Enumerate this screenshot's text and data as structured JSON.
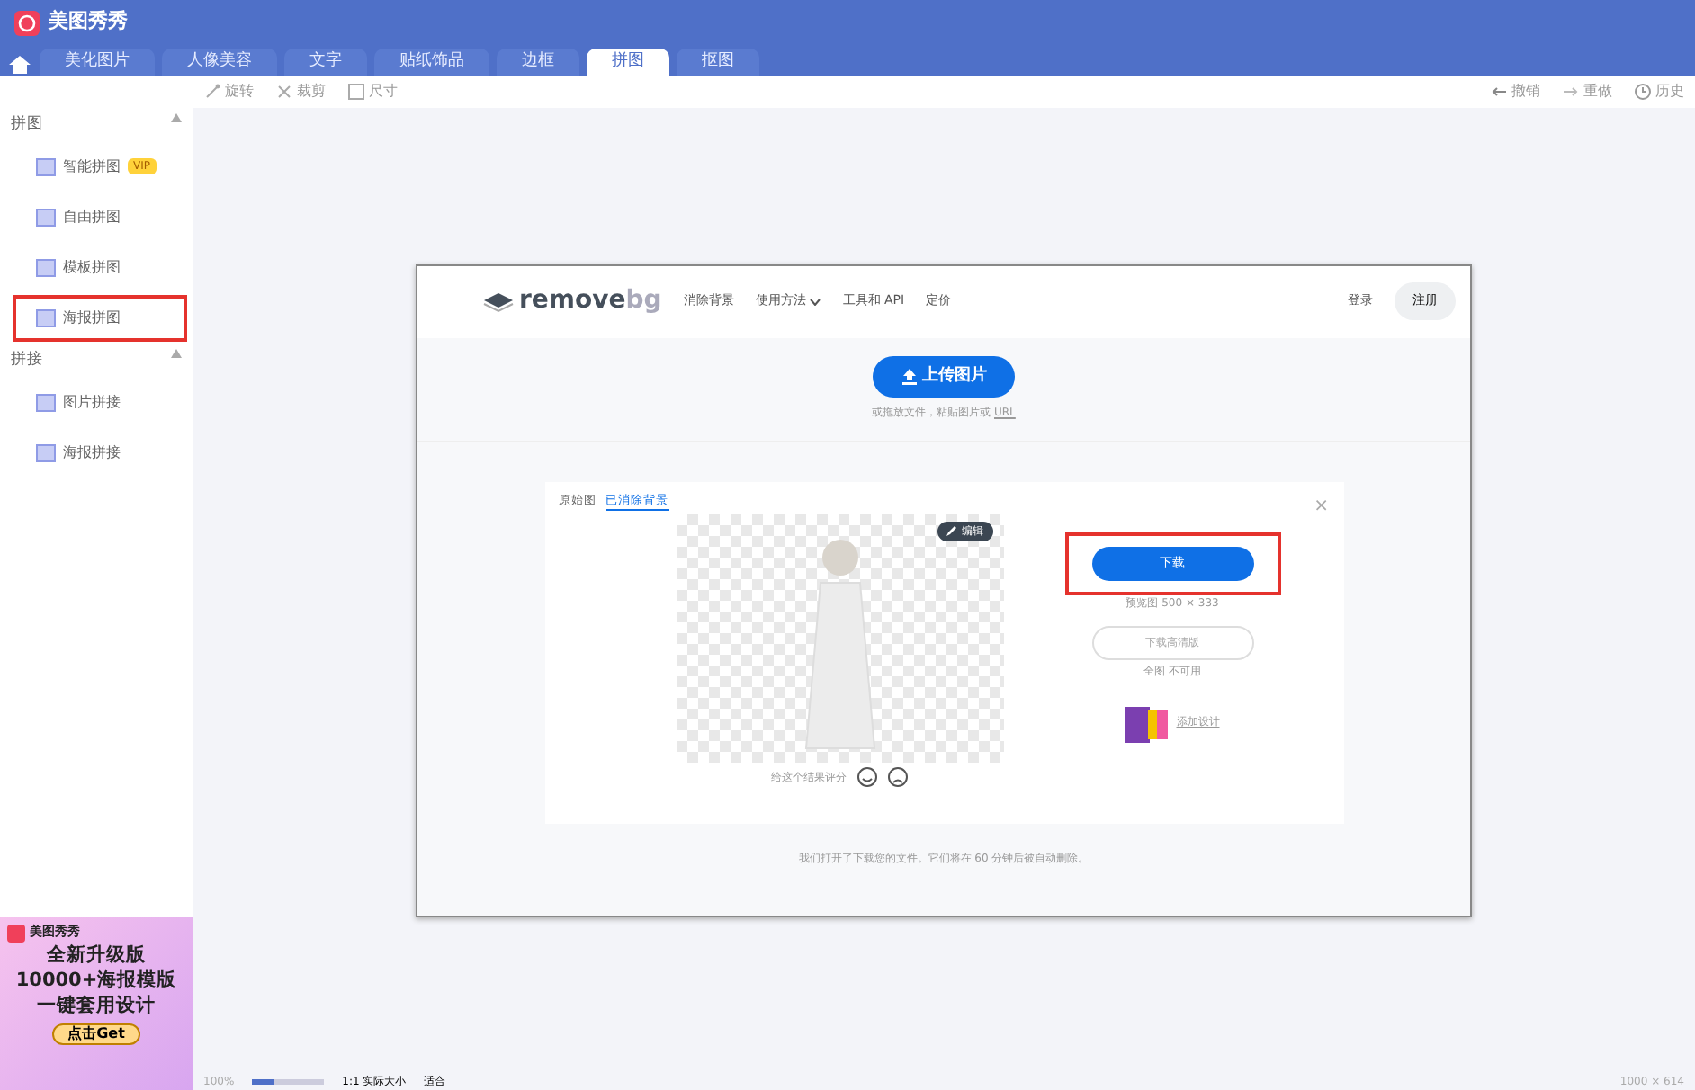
{
  "app": {
    "title": "美图秀秀"
  },
  "tabs": [
    {
      "label": "美化图片",
      "selected": false
    },
    {
      "label": "人像美容",
      "selected": false
    },
    {
      "label": "文字",
      "selected": false
    },
    {
      "label": "贴纸饰品",
      "selected": false
    },
    {
      "label": "边框",
      "selected": false
    },
    {
      "label": "拼图",
      "selected": true
    },
    {
      "label": "抠图",
      "selected": false
    }
  ],
  "toolbar": {
    "left": [
      {
        "kind": "rotate",
        "label": "旋转"
      },
      {
        "kind": "crop",
        "label": "裁剪"
      },
      {
        "kind": "size",
        "label": "尺寸"
      }
    ],
    "right": [
      {
        "kind": "undo",
        "label": "撤销"
      },
      {
        "kind": "redo",
        "label": "重做"
      },
      {
        "kind": "history",
        "label": "历史"
      }
    ]
  },
  "sidebar": [
    {
      "title": "拼图",
      "expanded": true,
      "items": [
        {
          "label": "智能拼图",
          "badge": "VIP",
          "highlighted": false
        },
        {
          "label": "自由拼图",
          "highlighted": false
        },
        {
          "label": "模板拼图",
          "highlighted": false
        },
        {
          "label": "海报拼图",
          "highlighted": true
        }
      ]
    },
    {
      "title": "拼接",
      "expanded": true,
      "items": [
        {
          "label": "图片拼接",
          "highlighted": false
        },
        {
          "label": "海报拼接",
          "highlighted": false
        }
      ]
    }
  ],
  "ad": {
    "brand": "美图秀秀",
    "lines": [
      "全新升级版",
      "10000+海报模版",
      "一键套用设计"
    ],
    "button": "点击Get"
  },
  "webpage": {
    "logo_a": "remove",
    "logo_b": "bg",
    "nav": [
      {
        "label": "消除背景",
        "dropdown": false
      },
      {
        "label": "使用方法",
        "dropdown": true
      },
      {
        "label": "工具和 API",
        "dropdown": false
      },
      {
        "label": "定价",
        "dropdown": false
      }
    ],
    "login": "登录",
    "signup": "注册",
    "upload": "上传图片",
    "upload_hint": "或拖放文件，粘贴图片或 ",
    "upload_link": "URL",
    "result_tabs": [
      {
        "label": "原始图",
        "selected": false
      },
      {
        "label": "已消除背景",
        "selected": true
      }
    ],
    "edit": "编辑",
    "close": "×",
    "download": {
      "label": "下载",
      "highlighted": true
    },
    "download_note": "预览图 500 × 333",
    "hd_button": "下载高清版",
    "hd_note": "全图 不可用",
    "design_link": "添加设计",
    "rate": "给这个结果评分",
    "footer": "我们打开了下载您的文件。它们将在 60 分钟后被自动删除。"
  },
  "status_bar": {
    "zoom": "100%",
    "zoom_slider": {
      "level": 0.3
    },
    "actual": "1:1 实际大小",
    "fit": "适合",
    "size": "1000 × 614"
  }
}
